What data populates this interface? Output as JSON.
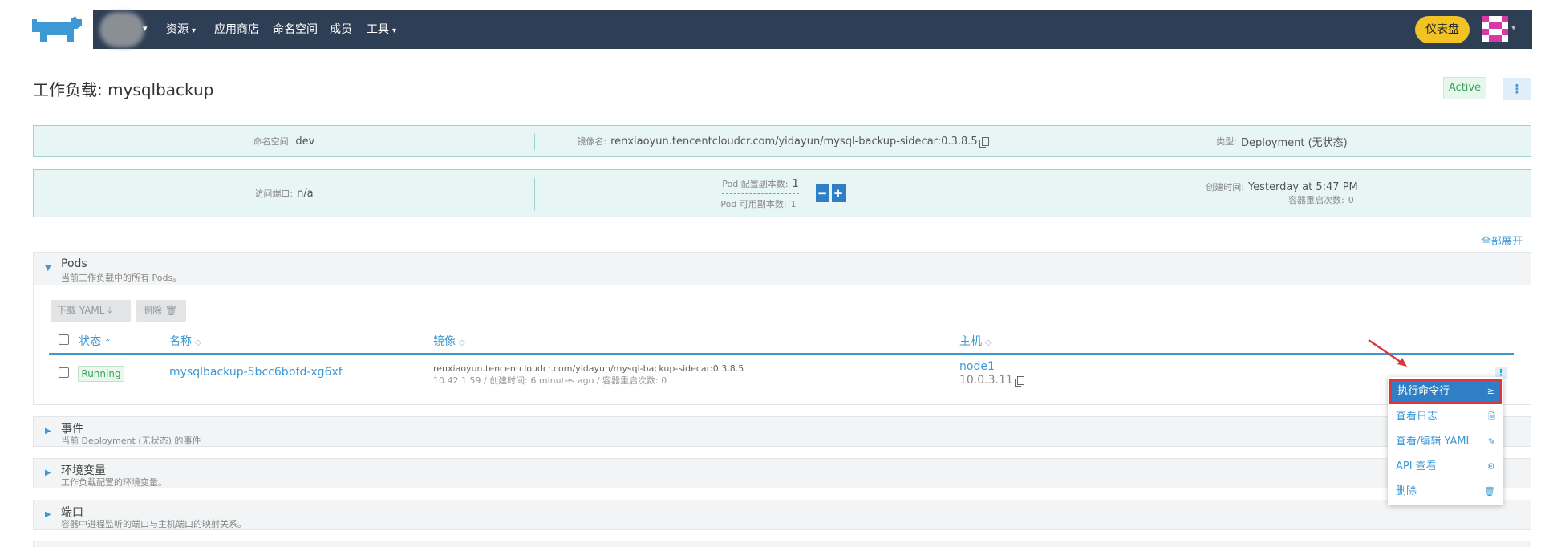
{
  "nav": {
    "items": [
      {
        "label": "资源",
        "dropdown": true
      },
      {
        "label": "应用商店",
        "dropdown": false
      },
      {
        "label": "命名空间",
        "dropdown": false
      },
      {
        "label": "成员",
        "dropdown": false
      },
      {
        "label": "工具",
        "dropdown": true
      }
    ],
    "dashboard_label": "仪表盘"
  },
  "page": {
    "title": "工作负载: mysqlbackup",
    "status": "Active"
  },
  "info": {
    "namespace_label": "命名空间:",
    "namespace": "dev",
    "image_label": "镜像名:",
    "image": "renxiaoyun.tencentcloudcr.com/yidayun/mysql-backup-sidecar:0.3.8.5",
    "type_label": "类型:",
    "type": "Deployment (无状态)",
    "port_label": "访问端口:",
    "port": "n/a",
    "replicas_config_label": "Pod 配置副本数:",
    "replicas_config": "1",
    "replicas_avail_label": "Pod 可用副本数:",
    "replicas_avail": "1",
    "created_label": "创建时间:",
    "created": "Yesterday at 5:47 PM",
    "restarts_label": "容器重启次数:",
    "restarts": "0"
  },
  "expand_all": "全部展开",
  "sections": {
    "pods": {
      "title": "Pods",
      "subtitle": "当前工作负载中的所有 Pods。"
    },
    "events": {
      "title": "事件",
      "subtitle": "当前 Deployment (无状态) 的事件"
    },
    "env": {
      "title": "环境变量",
      "subtitle": "工作负载配置的环境变量。"
    },
    "ports": {
      "title": "端口",
      "subtitle": "容器中进程监听的端口与主机端口的映射关系。"
    }
  },
  "pods_toolbar": {
    "download_yaml": "下载 YAML",
    "delete": "删除"
  },
  "table": {
    "headers": [
      "状态",
      "名称",
      "镜像",
      "主机"
    ],
    "rows": [
      {
        "status": "Running",
        "name": "mysqlbackup-5bcc6bbfd-xg6xf",
        "image": "renxiaoyun.tencentcloudcr.com/yidayun/mysql-backup-sidecar:0.3.8.5",
        "meta": "10.42.1.59 / 创建时间: 6 minutes ago / 容器重启次数: 0",
        "node": "node1",
        "ip": "10.0.3.11"
      }
    ]
  },
  "row_menu": {
    "items": [
      {
        "label": "执行命令行",
        "icon": "≥"
      },
      {
        "label": "查看日志",
        "icon": "🗎"
      },
      {
        "label": "查看/编辑 YAML",
        "icon": "✎"
      },
      {
        "label": "API 查看",
        "icon": "⚙"
      },
      {
        "label": "删除",
        "icon": "🗑"
      }
    ]
  },
  "colors": {
    "navbar": "#2e3e54",
    "accent": "#3d98d3",
    "dashboard": "#f3c223",
    "highlight_border": "#e0353a"
  }
}
